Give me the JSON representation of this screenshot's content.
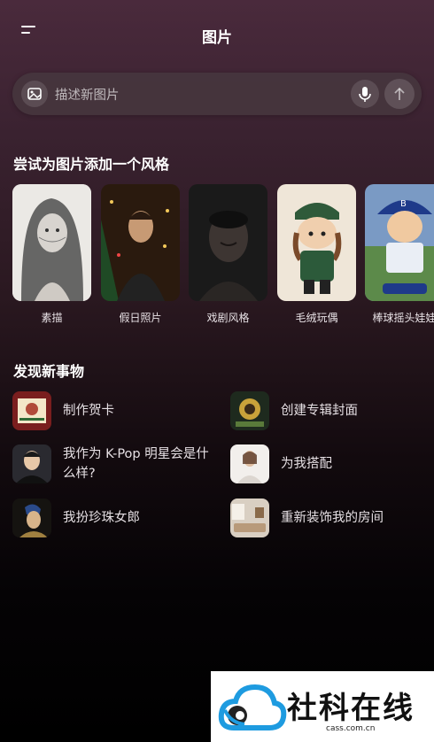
{
  "header": {
    "title": "图片",
    "menu_icon": "menu-icon"
  },
  "search": {
    "placeholder": "描述新图片",
    "left_icon": "image-icon",
    "mic_icon": "mic-icon",
    "send_icon": "arrow-up-icon"
  },
  "styles_section": {
    "title": "尝试为图片添加一个风格",
    "items": [
      {
        "label": "素描"
      },
      {
        "label": "假日照片"
      },
      {
        "label": "戏剧风格"
      },
      {
        "label": "毛绒玩偶"
      },
      {
        "label": "棒球摇头娃娃"
      }
    ]
  },
  "discover_section": {
    "title": "发现新事物",
    "items": [
      {
        "label": "制作贺卡"
      },
      {
        "label": "创建专辑封面"
      },
      {
        "label": "我作为 K-Pop 明星会是什么样?"
      },
      {
        "label": "为我搭配"
      },
      {
        "label": "我扮珍珠女郎"
      },
      {
        "label": "重新装饰我的房间"
      }
    ]
  },
  "watermark": {
    "brand": "社科在线",
    "url": "cass.com.cn"
  }
}
